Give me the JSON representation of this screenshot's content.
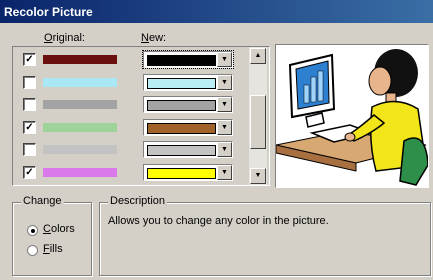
{
  "window": {
    "title": "Recolor Picture"
  },
  "columns": {
    "original_prefix": "O",
    "original_rest": "riginal:",
    "new_prefix": "N",
    "new_rest": "ew:"
  },
  "rows": [
    {
      "checked": true,
      "original_color": "#6b0e0e",
      "new_color": "#000000"
    },
    {
      "checked": false,
      "original_color": "#a9e8f2",
      "new_color": "#b9eef4"
    },
    {
      "checked": false,
      "original_color": "#a3a3a3",
      "new_color": "#a3a3a3"
    },
    {
      "checked": true,
      "original_color": "#9fd39b",
      "new_color": "#a0642a"
    },
    {
      "checked": false,
      "original_color": "#c3c3c3",
      "new_color": "#c3c3c3"
    },
    {
      "checked": true,
      "original_color": "#da7aea",
      "new_color": "#ffff00"
    }
  ],
  "change": {
    "legend": "Change",
    "colors_prefix": "C",
    "colors_rest": "olors",
    "fills_prefix": "F",
    "fills_rest": "ills",
    "selected": "colors"
  },
  "description": {
    "legend": "Description",
    "text": "Allows you to change any color in the picture."
  },
  "icons": {
    "checkbox_mark": "✓",
    "dropdown": "▼",
    "scroll_up": "▲",
    "scroll_down": "▼"
  }
}
